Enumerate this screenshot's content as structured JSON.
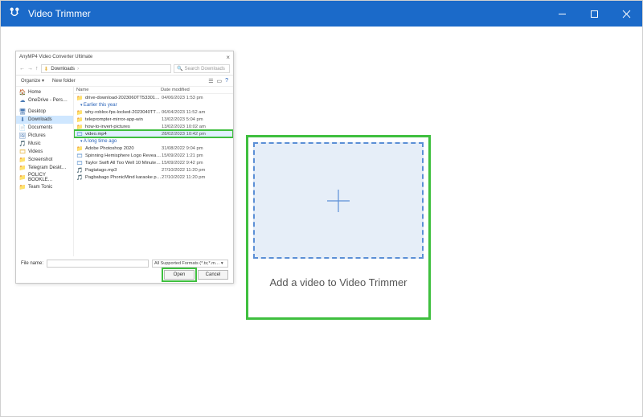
{
  "window": {
    "title": "Video Trimmer"
  },
  "drop": {
    "caption": "Add a video to Video Trimmer"
  },
  "dialog": {
    "title": "AnyMP4 Video Converter Ultimate",
    "crumb_folder": "Downloads",
    "search_placeholder": "Search Downloads",
    "organize": "Organize ▾",
    "newfolder": "New folder",
    "cols": {
      "name": "Name",
      "modified": "Date modified"
    },
    "side": [
      {
        "ic": "🏠",
        "label": "Home"
      },
      {
        "ic": "☁",
        "label": "OneDrive - Pers…"
      },
      {
        "ic": "🖥",
        "label": "Desktop"
      },
      {
        "ic": "⬇",
        "label": "Downloads"
      },
      {
        "ic": "📄",
        "label": "Documents"
      },
      {
        "ic": "🖼",
        "label": "Pictures"
      },
      {
        "ic": "🎵",
        "label": "Music"
      },
      {
        "ic": "🎞",
        "label": "Videos"
      },
      {
        "ic": "📁",
        "label": "Screenshot"
      },
      {
        "ic": "📁",
        "label": "Telegram Deskt…"
      },
      {
        "ic": "📁",
        "label": "POLICY BOOKLE…"
      },
      {
        "ic": "📁",
        "label": "Team Tonic"
      }
    ],
    "side_sel": 3,
    "rows": [
      {
        "ic": "📁",
        "name": "drive-download-2023060TT53301UAZ-001",
        "date": "04/06/2023 1:53 pm"
      }
    ],
    "group1": "Earlier this year",
    "rows1": [
      {
        "ic": "📁",
        "name": "why-roblox-fps-locked-2023040TT15241-0…",
        "date": "06/04/2023 11:52 am"
      },
      {
        "ic": "📁",
        "name": "teleprompter-mirror-app-win",
        "date": "13/02/2023 5:04 pm"
      },
      {
        "ic": "📁",
        "name": "how-to-invert-pictures",
        "date": "13/02/2023 10:02 am"
      },
      {
        "ic": "🎞",
        "name": "video.mp4",
        "date": "28/02/2023 10:42 pm",
        "sel": true
      }
    ],
    "group2": "A long time ago",
    "rows2": [
      {
        "ic": "📁",
        "name": "Adobe Photoshop 2020",
        "date": "31/08/2022 9:04 pm"
      },
      {
        "ic": "🎞",
        "name": "Spinning Hemisphere Logo Reveal_free-…",
        "date": "15/09/2022 1:21 pm"
      },
      {
        "ic": "🎞",
        "name": "Taylor Swift  All Too Well 10 Minute Versi…",
        "date": "15/09/2022 9:42 pm"
      },
      {
        "ic": "🎵",
        "name": "Pagtatago.mp3",
        "date": "27/10/2022 11:20 pm"
      },
      {
        "ic": "🎵",
        "name": "Pagbabago PhonicMind karaoke preview.…",
        "date": "27/10/2022 11:20 pm"
      }
    ],
    "filename_label": "File name:",
    "filter": "All Supported Formats (*.ts;*.m… ▾",
    "open": "Open",
    "cancel": "Cancel"
  }
}
